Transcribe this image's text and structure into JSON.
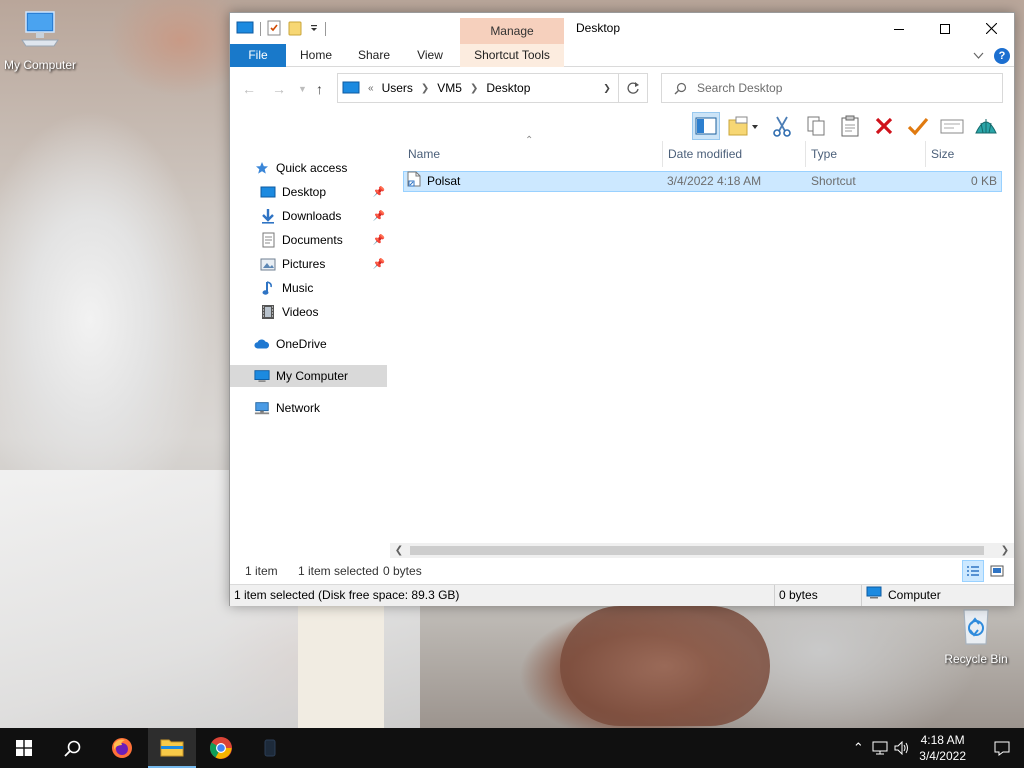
{
  "desktop": {
    "icons": [
      {
        "label": "My Computer"
      },
      {
        "label": "Recycle Bin"
      }
    ]
  },
  "window": {
    "title": "Desktop",
    "context_tab_group": "Manage",
    "ribbon_tabs": [
      "File",
      "Home",
      "Share",
      "View",
      "Shortcut Tools"
    ],
    "address": {
      "overflow": "«",
      "crumbs": [
        "Users",
        "VM5",
        "Desktop"
      ]
    },
    "search_placeholder": "Search Desktop",
    "nav": {
      "quick_access": "Quick access",
      "pinned": [
        "Desktop",
        "Downloads",
        "Documents",
        "Pictures"
      ],
      "unpinned": [
        "Music",
        "Videos"
      ],
      "onedrive": "OneDrive",
      "this_pc": "My Computer",
      "network": "Network"
    },
    "columns": [
      "Name",
      "Date modified",
      "Type",
      "Size"
    ],
    "files": [
      {
        "name": "Polsat",
        "date": "3/4/2022 4:18 AM",
        "type": "Shortcut",
        "size": "0 KB"
      }
    ],
    "status": {
      "count": "1 item",
      "selected": "1 item selected",
      "bytes": "0 bytes"
    },
    "details_bar": {
      "info": "1 item selected (Disk free space: 89.3 GB)",
      "size": "0 bytes",
      "location": "Computer"
    }
  },
  "taskbar": {
    "time": "4:18 AM",
    "date": "3/4/2022"
  },
  "colors": {
    "file_tab": "#1979ca",
    "manage_header": "#f6d0bd",
    "selection": "#cce8ff",
    "taskbar": "#101010"
  }
}
